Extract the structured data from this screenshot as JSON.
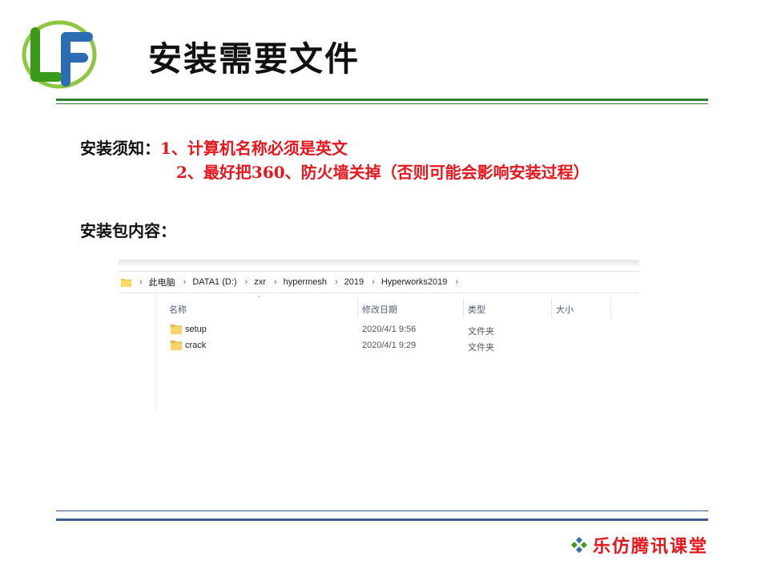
{
  "logo": {
    "letters": "LF",
    "colors": {
      "L": "#3a9a1c",
      "F": "#2b6cb3",
      "swoosh": "#8dc63f"
    }
  },
  "slide": {
    "title": "安装需要文件",
    "notice_label": "安装须知：",
    "notice_item1": "1、计算机名称必须是英文",
    "notice_item2": "2、最好把360、防火墙关掉（否则可能会影响安装过程）",
    "package_label": "安装包内容："
  },
  "explorer": {
    "breadcrumbs": [
      "此电脑",
      "DATA1 (D:)",
      "zxr",
      "hypermesh",
      "2019",
      "Hyperworks2019"
    ],
    "columns": {
      "name": "名称",
      "modified": "修改日期",
      "type": "类型",
      "size": "大小"
    },
    "rows": [
      {
        "name": "setup",
        "modified": "2020/4/1 9:56",
        "type": "文件夹",
        "size": ""
      },
      {
        "name": "crack",
        "modified": "2020/4/1 9:29",
        "type": "文件夹",
        "size": ""
      }
    ]
  },
  "footer": {
    "brand": "乐仿腾讯课堂",
    "icon": "four-diamond-dots-icon"
  },
  "colors": {
    "accent_red": "#e8151b",
    "rule_green": "#2e7d32",
    "rule_blue": "#3b5e8c",
    "folder": "#f4c84f"
  }
}
